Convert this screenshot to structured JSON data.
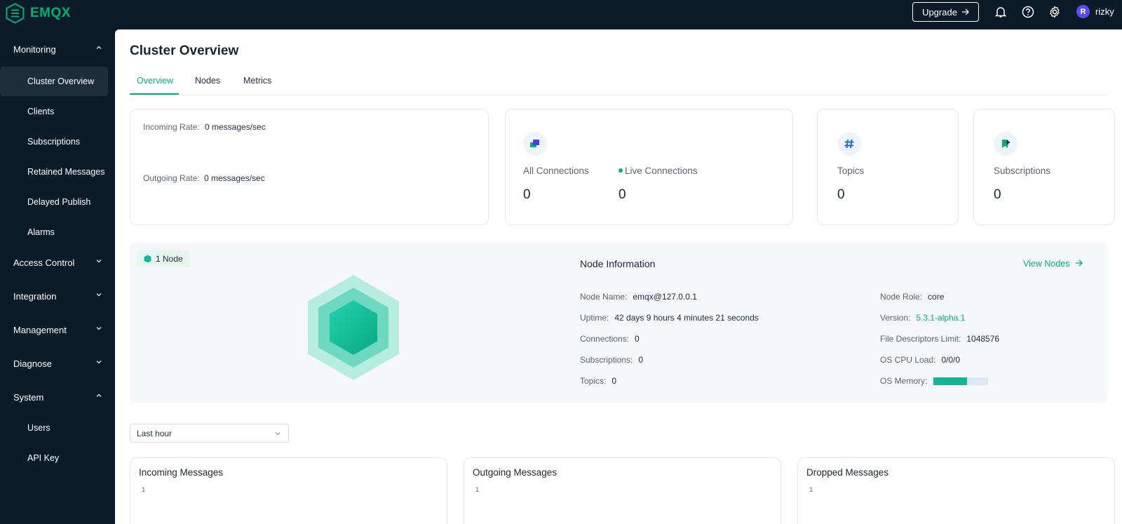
{
  "app": {
    "logo_text": "EMQX"
  },
  "header": {
    "upgrade_label": "Upgrade",
    "user_initial": "R",
    "username": "rizky"
  },
  "sidebar": {
    "groups": [
      {
        "label": "Monitoring",
        "expanded": true,
        "items": [
          "Cluster Overview",
          "Clients",
          "Subscriptions",
          "Retained Messages",
          "Delayed Publish",
          "Alarms"
        ]
      },
      {
        "label": "Access Control",
        "expanded": false
      },
      {
        "label": "Integration",
        "expanded": false
      },
      {
        "label": "Management",
        "expanded": false
      },
      {
        "label": "Diagnose",
        "expanded": false
      },
      {
        "label": "System",
        "expanded": true,
        "items": [
          "Users",
          "API Key"
        ]
      }
    ],
    "active_item": "Cluster Overview"
  },
  "page": {
    "title": "Cluster Overview",
    "tabs": [
      "Overview",
      "Nodes",
      "Metrics"
    ],
    "active_tab": "Overview"
  },
  "rates": {
    "incoming_label": "Incoming Rate:",
    "incoming_value": "0 messages/sec",
    "outgoing_label": "Outgoing Rate:",
    "outgoing_value": "0 messages/sec"
  },
  "stats": {
    "all_connections_label": "All Connections",
    "all_connections_value": "0",
    "live_connections_label": "Live Connections",
    "live_connections_value": "0",
    "topics_label": "Topics",
    "topics_value": "0",
    "subscriptions_label": "Subscriptions",
    "subscriptions_value": "0"
  },
  "node": {
    "badge": "1 Node",
    "info_title": "Node Information",
    "view_nodes": "View Nodes",
    "left": [
      {
        "label": "Node Name:",
        "value": "emqx@127.0.0.1"
      },
      {
        "label": "Uptime:",
        "value": "42 days 9 hours 4 minutes 21 seconds"
      },
      {
        "label": "Connections:",
        "value": "0"
      },
      {
        "label": "Subscriptions:",
        "value": "0"
      },
      {
        "label": "Topics:",
        "value": "0"
      }
    ],
    "right": [
      {
        "label": "Node Role:",
        "value": "core"
      },
      {
        "label": "Version:",
        "value": "5.3.1-alpha.1"
      },
      {
        "label": "File Descriptors Limit:",
        "value": "1048576"
      },
      {
        "label": "OS CPU Load:",
        "value": "0/0/0"
      },
      {
        "label": "OS Memory:",
        "value": ""
      }
    ],
    "os_memory_fraction": 0.62
  },
  "time_range": {
    "selected": "Last hour"
  },
  "charts": [
    {
      "title": "Incoming Messages",
      "tick": "1"
    },
    {
      "title": "Outgoing Messages",
      "tick": "1"
    },
    {
      "title": "Dropped Messages",
      "tick": "1"
    }
  ],
  "colors": {
    "accent": "#00b173",
    "sidebar_bg": "#0c1b2a",
    "memory_fill": "#13b594"
  }
}
